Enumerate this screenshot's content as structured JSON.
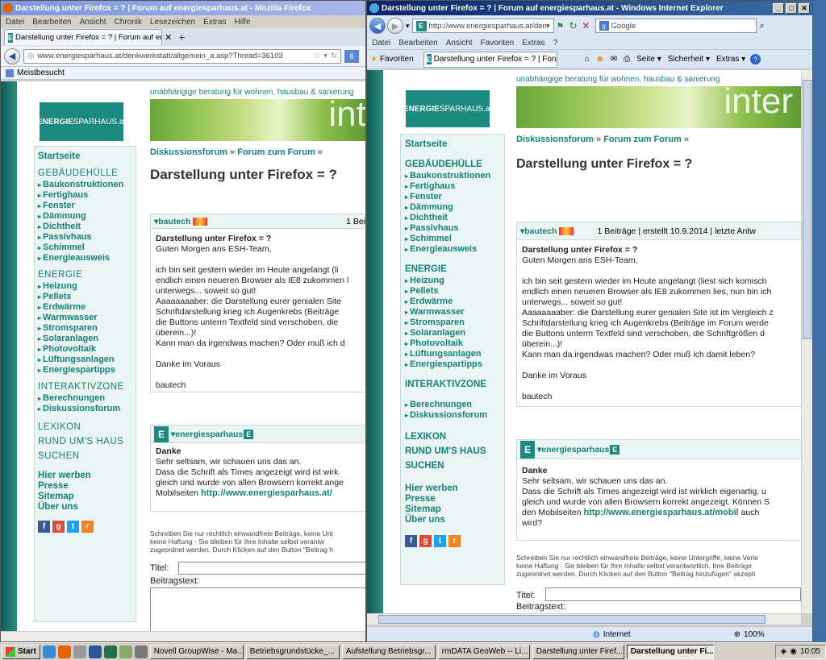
{
  "firefox": {
    "title": "Darstellung unter Firefox = ? | Forum auf energiesparhaus.at - Mozilla Firefox",
    "menu": [
      "Datei",
      "Bearbeiten",
      "Ansicht",
      "Chronik",
      "Lesezeichen",
      "Extras",
      "Hilfe"
    ],
    "tab_label": "Darstellung unter Firefox = ? | Forum auf en...",
    "new_tab": "+",
    "url": "www.energiesparhaus.at/denkwerkstatt/allgemein_a.asp?Thread=36103",
    "bookmark": "Meistbesucht"
  },
  "ie": {
    "title": "Darstellung unter Firefox = ? | Forum auf energiesparhaus.at - Windows Internet Explorer",
    "url": "http://www.energiesparhaus.at/denk",
    "search_placeholder": "Google",
    "menu": [
      "Datei",
      "Bearbeiten",
      "Ansicht",
      "Favoriten",
      "Extras",
      "?"
    ],
    "favorites": "Favoriten",
    "tab_label": "Darstellung unter Firefox = ? | Foru...",
    "toolbar": [
      "Seite ▾",
      "Sicherheit ▾",
      "Extras ▾"
    ],
    "status_zone": "Internet",
    "zoom": "100%"
  },
  "site": {
    "tagline": "unabhängige beratung für wohnen, hausbau & sanierung",
    "logo_a": "ENERGIE",
    "logo_b": "SPARHAUS",
    "logo_c": ".at",
    "banner_word": "inter",
    "nav": {
      "home": "Startseite",
      "sec1": "GEBÄUDEHÜLLE",
      "sec1_items": [
        "Baukonstruktionen",
        "Fertighaus",
        "Fenster",
        "Dämmung",
        "Dichtheit",
        "Passivhaus",
        "Schimmel",
        "Energieausweis"
      ],
      "sec2": "ENERGIE",
      "sec2_items": [
        "Heizung",
        "Pellets",
        "Erdwärme",
        "Warmwasser",
        "Stromsparen",
        "Solaranlagen",
        "Photovoltaik",
        "Lüftungsanlagen",
        "Energiespartipps"
      ],
      "sec3": "INTERAKTIVZONE",
      "sec3_items": [
        "Berechnungen",
        "Diskussionsforum"
      ],
      "lexikon": "LEXIKON",
      "rund": "RUND UM'S HAUS",
      "suchen": "SUCHEN",
      "footer_items": [
        "Hier werben",
        "Presse",
        "Sitemap",
        "Über uns"
      ]
    },
    "crumb_a": "Diskussionsforum",
    "crumb_sep": " » ",
    "crumb_b": "Forum zum Forum",
    "crumb_end": " »",
    "heading": "Darstellung unter Firefox = ?",
    "post1": {
      "user": "▾bautech",
      "meta_ff": "1 Beit",
      "meta_ie": "1 Beiträge | erstellt 10.9.2014 | letzte Antw",
      "subject": "Darstellung unter Firefox = ?",
      "greeting": "Guten Morgen ans ESH-Team,",
      "ff_lines": [
        "ich bin seit gestern wieder im Heute angelangt (li",
        "endlich einen neueren Browser als IE8 zukommen l",
        "unterwegs... soweit so gut!",
        "Aaaaaaaaber: die Darstellung eurer genialen Site",
        "Schriftdarstellung krieg ich Augenkrebs (Beiträge",
        "die Buttons unterm Textfeld sind verschoben, die",
        "überein...)!",
        "Kann man da irgendwas machen? Oder muß ich d"
      ],
      "ie_lines": [
        "ich bin seit gestern wieder im Heute angelangt (liest sich komisch",
        "endlich einen neueren Browser als IE8 zukommen lies, nun bin ich",
        "unterwegs... soweit so gut!",
        "Aaaaaaaaber: die Darstellung eurer genialen Site ist im Vergleich z",
        "Schriftdarstellung krieg ich Augenkrebs (Beiträge im Forum werde",
        "die Buttons unterm Textfeld sind verschoben, die Schriftgrößen d",
        "überein...)!",
        "Kann man da irgendwas machen? Oder muß ich damit leben?"
      ],
      "thanks": "Danke im Voraus",
      "sig": "bautech"
    },
    "post2": {
      "user": "▾energiesparhaus",
      "subject": "Danke",
      "ff_lines": [
        "Sehr seltsam, wir schauen uns das an.",
        "Dass die Schrift als Times angezeigt wird ist wirk",
        "gleich und wurde von allen Browsern korrekt ange",
        "Mobilseiten "
      ],
      "ff_link": "http://www.energiesparhaus.at/",
      "ie_lines": [
        "Sehr seltsam, wir schauen uns das an.",
        "Dass die Schrift als Times angezeigt wird ist wirklich eigenartig, u",
        "gleich und wurde von allen Browsern korrekt angezeigt. Können S",
        "den Mobilseiten "
      ],
      "ie_link": "http://www.energiesparhaus.at/mobil",
      "ie_tail": " auch",
      "ie_last": "wird?"
    },
    "legal_ff": [
      "Schreiben Sie nur rechtlich einwandfreie Beiträge, keine Unt",
      "keine Haftung - Sie bleiben für Ihre Inhalte selbst verantw",
      "zugeordnet werden. Durch Klicken auf den Button \"Beitrag h"
    ],
    "legal_ie": [
      "Schreiben Sie nur rechtlich einwandfreie Beiträge, keine Untergriffe, keine Verle",
      "keine Haftung - Sie bleiben für Ihre Inhalte selbst verantwortlich. Ihre Beiträge",
      "zugeordnet werden. Durch Klicken auf den Button \"Beitrag hinzufügen\" akzepti"
    ],
    "title_label": "Titel:",
    "text_label": "Beitragstext:"
  },
  "taskbar": {
    "start": "Start",
    "items": [
      "Novell GroupWise - Ma...",
      "Betriebsgrundstücke_...",
      "Aufstellung Betriebsgr...",
      "rmDATA GeoWeb -- Li...",
      "Darstellung unter Firef...",
      "Darstellung unter Fi..."
    ],
    "clock": "10:05"
  }
}
